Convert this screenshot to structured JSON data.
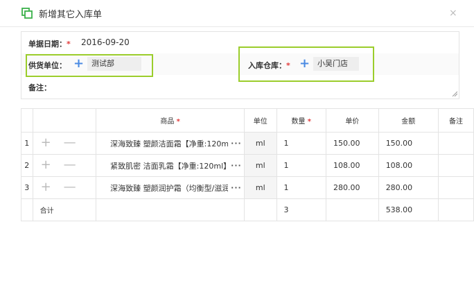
{
  "dialog": {
    "title": "新增其它入库单",
    "close_glyph": "×"
  },
  "form": {
    "date_label": "单据日期：",
    "date_value": "2016-09-20",
    "supplier_label": "供货单位：",
    "supplier_value": "测试部",
    "warehouse_label": "入库仓库：",
    "warehouse_value": "小吴门店",
    "note_label": "备注：",
    "required_mark": "*",
    "add_glyph": "+"
  },
  "table": {
    "headers": {
      "product": "商品",
      "unit": "单位",
      "qty": "数量",
      "price": "单价",
      "amount": "金额",
      "note": "备注"
    },
    "required_mark": "*",
    "row_add_glyph": "+",
    "row_remove_glyph": "—",
    "more_glyph": "···",
    "rows": [
      {
        "idx": "1",
        "product": "深海致臻 塑颜洁面霜【净重:120ml",
        "unit": "ml",
        "qty": "1",
        "price": "150.00",
        "amount": "150.00",
        "note": ""
      },
      {
        "idx": "2",
        "product": "紧致肌密 洁面乳霜【净重:120ml】",
        "unit": "ml",
        "qty": "1",
        "price": "108.00",
        "amount": "108.00",
        "note": ""
      },
      {
        "idx": "3",
        "product": "深海致臻 塑颜润护霜（均衡型/滋润",
        "unit": "ml",
        "qty": "1",
        "price": "280.00",
        "amount": "280.00",
        "note": ""
      }
    ],
    "total": {
      "label": "合计",
      "qty": "3",
      "amount": "538.00"
    }
  },
  "colors": {
    "accent_blue": "#4a8be3",
    "highlight_green": "#9bcd2b",
    "title_icon_green": "#3bb04a",
    "required_red": "#e23b3b"
  }
}
